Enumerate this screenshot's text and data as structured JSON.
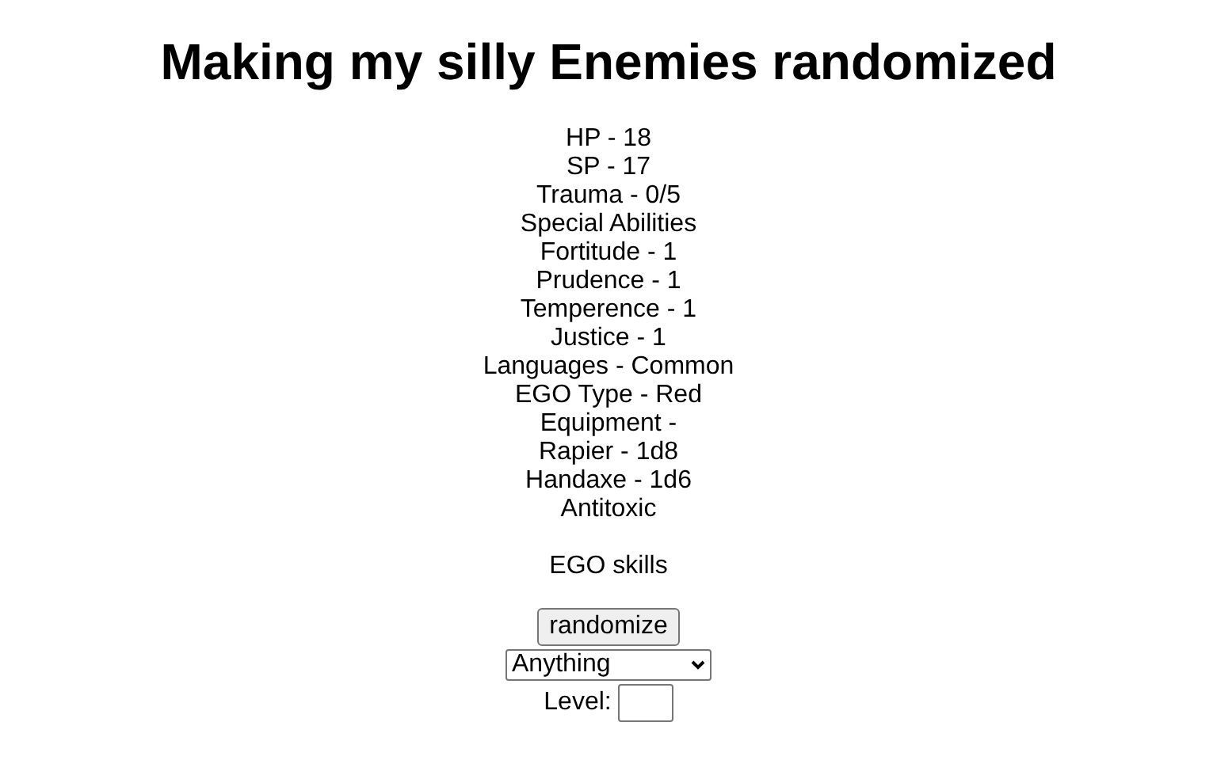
{
  "title": "Making my silly Enemies randomized",
  "stats": [
    "HP - 18",
    "SP - 17",
    "Trauma - 0/5",
    "Special Abilities",
    "Fortitude - 1",
    "Prudence - 1",
    "Temperence - 1",
    "Justice - 1",
    "Languages - Common",
    "EGO Type - Red",
    "Equipment -",
    "Rapier - 1d8",
    "Handaxe - 1d6",
    "Antitoxic"
  ],
  "ego_skills": "EGO skills",
  "randomize_button": "randomize",
  "type_select": {
    "value": "Anything"
  },
  "level_field": {
    "label": "Level:"
  }
}
